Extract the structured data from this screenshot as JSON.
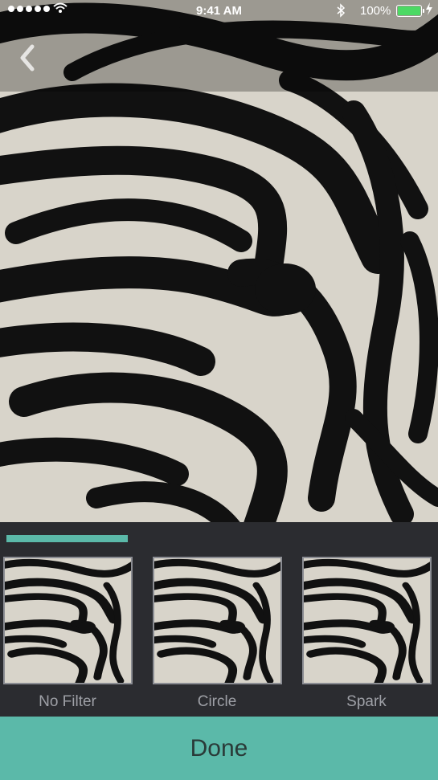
{
  "status_bar": {
    "time": "9:41 AM",
    "battery_percent": "100%",
    "battery_color": "#4cd964"
  },
  "nav": {
    "back_icon": "chevron-left-icon"
  },
  "filters": {
    "selected_index": 0,
    "accent_color": "#5bb9a9",
    "items": [
      {
        "label": "No Filter"
      },
      {
        "label": "Circle"
      },
      {
        "label": "Spark"
      }
    ]
  },
  "done_button": {
    "label": "Done",
    "color": "#5bb9a9"
  }
}
